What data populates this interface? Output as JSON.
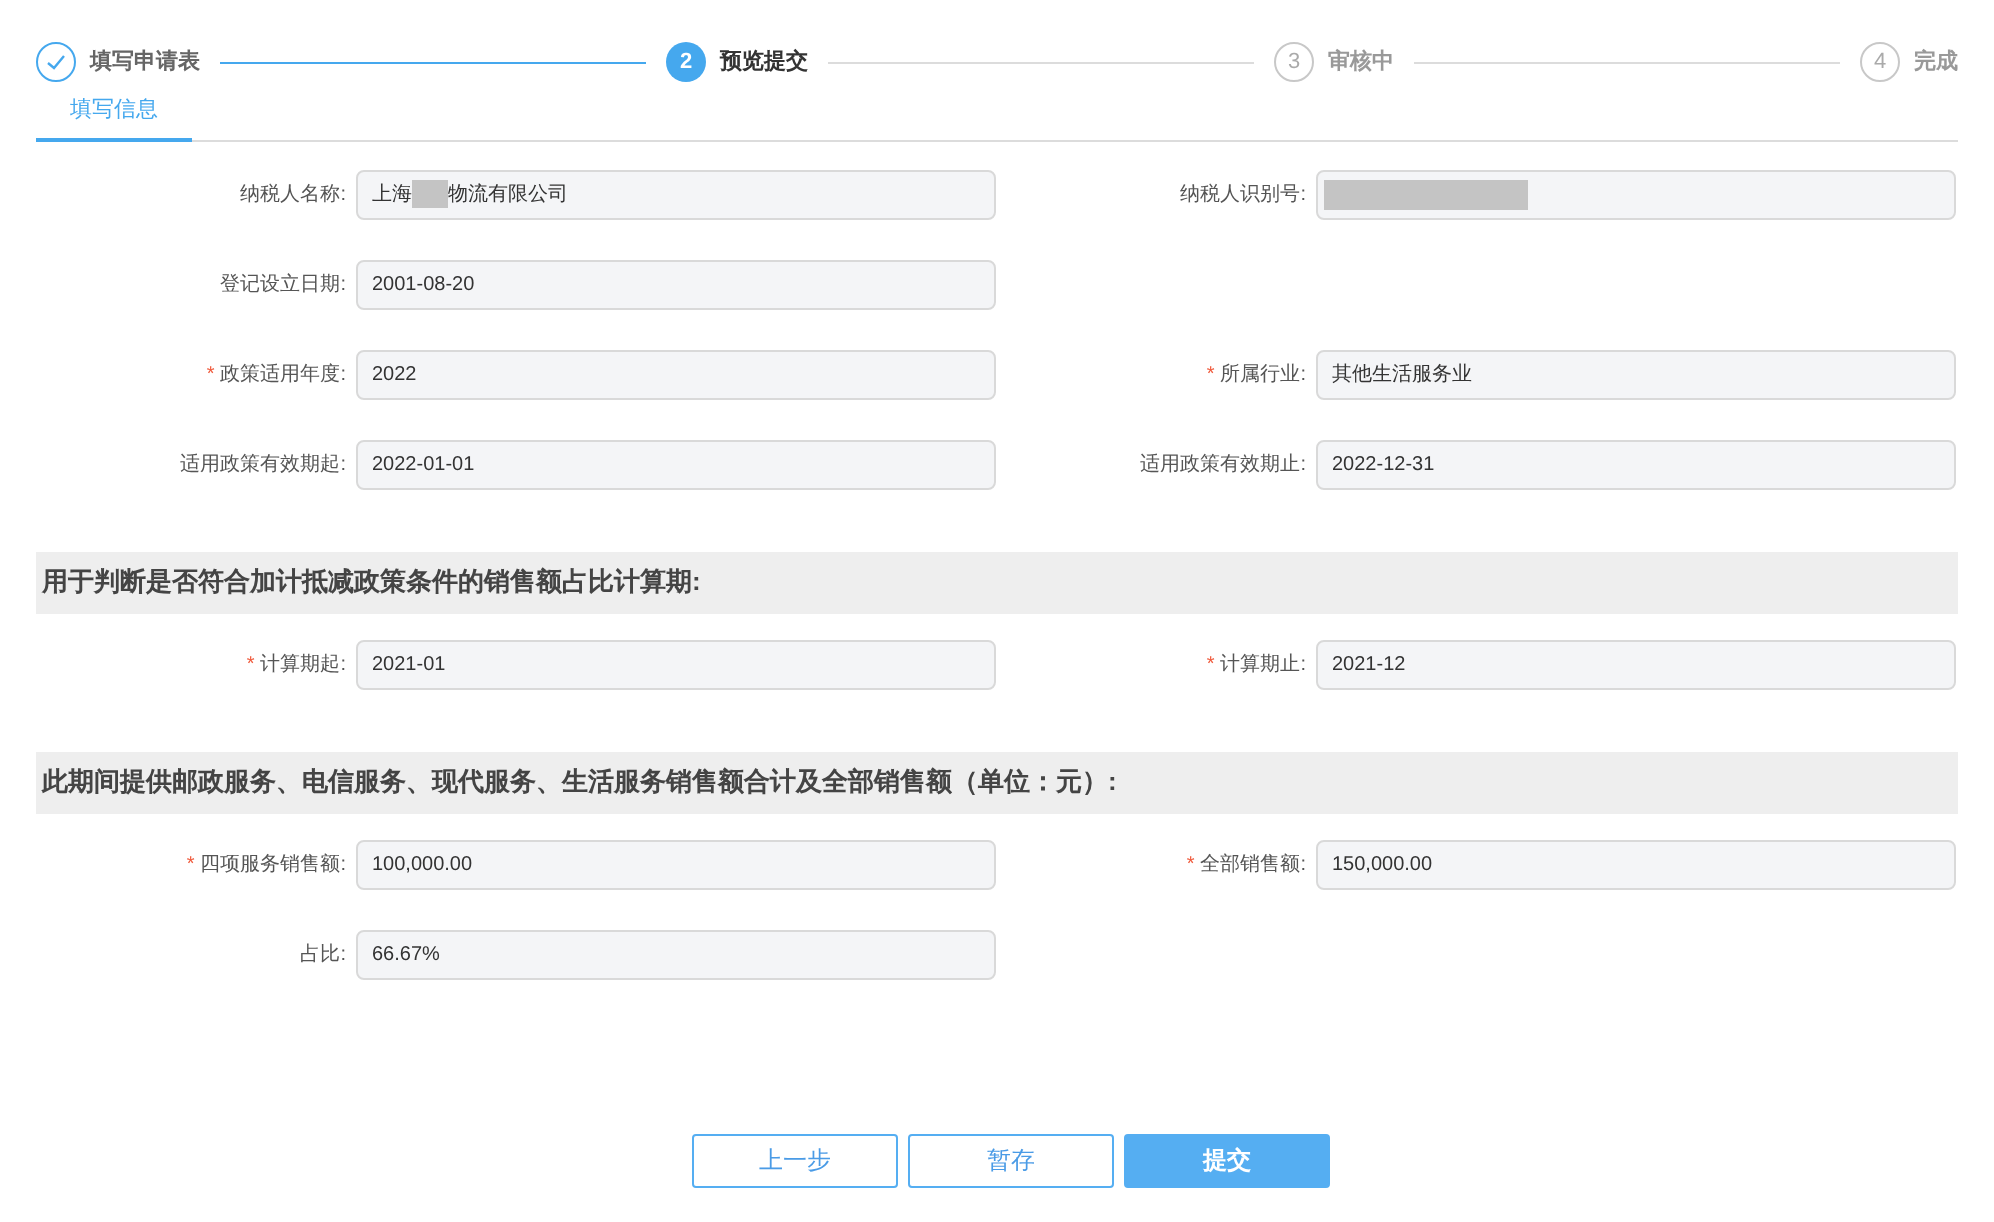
{
  "steps": [
    {
      "label": "填写申请表",
      "done": true,
      "active": false
    },
    {
      "number": "2",
      "label": "预览提交",
      "done": false,
      "active": true
    },
    {
      "number": "3",
      "label": "审核中",
      "done": false,
      "active": false
    },
    {
      "number": "4",
      "label": "完成",
      "done": false,
      "active": false
    }
  ],
  "tabs": [
    {
      "label": "填写信息",
      "selected": true
    }
  ],
  "sections": [
    {
      "rows": [
        [
          {
            "label": "纳税人名称:",
            "segments": [
              {
                "kind": "text",
                "text": "上海"
              },
              {
                "kind": "mask"
              },
              {
                "kind": "text",
                "text": "物流有限公司"
              }
            ]
          },
          {
            "label": "纳税人识别号:",
            "segments": [
              {
                "kind": "longmask"
              }
            ]
          }
        ],
        [
          {
            "label": "登记设立日期:",
            "value": "2001-08-20"
          }
        ],
        [
          {
            "marker": "*",
            "label": "政策适用年度:",
            "value": "2022"
          },
          {
            "marker": "*",
            "label": "所属行业:",
            "value": "其他生活服务业"
          }
        ],
        [
          {
            "label": "适用政策有效期起:",
            "value": "2022-01-01"
          },
          {
            "label": "适用政策有效期止:",
            "value": "2022-12-31"
          }
        ]
      ]
    },
    {
      "heading": "用于判断是否符合加计抵减政策条件的销售额占比计算期:",
      "rows": [
        [
          {
            "marker": "*",
            "label": "计算期起:",
            "value": "2021-01"
          },
          {
            "marker": "*",
            "label": "计算期止:",
            "value": "2021-12"
          }
        ]
      ]
    },
    {
      "heading": "此期间提供邮政服务、电信服务、现代服务、生活服务销售额合计及全部销售额（单位：元）:",
      "rows": [
        [
          {
            "marker": "*",
            "label": "四项服务销售额:",
            "value": "100,000.00"
          },
          {
            "marker": "*",
            "label": "全部销售额:",
            "value": "150,000.00"
          }
        ],
        [
          {
            "label": "占比:",
            "value": "66.67%"
          }
        ]
      ]
    }
  ],
  "buttons": [
    {
      "label": "上一步",
      "kind": "outline"
    },
    {
      "label": "暂存",
      "kind": "outline"
    },
    {
      "label": "提交",
      "kind": "primary"
    }
  ]
}
